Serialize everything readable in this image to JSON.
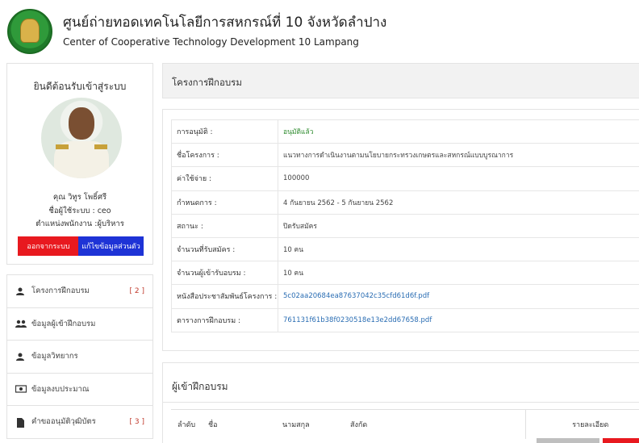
{
  "header": {
    "title_th": "ศูนย์ถ่ายทอดเทคโนโลยีการสหกรณ์ที่ 10 จังหวัดลำปาง",
    "title_en": "Center of Cooperative Technology Development 10 Lampang"
  },
  "profile": {
    "welcome": "ยินดีต้อนรับเข้าสู่ระบบ",
    "name": "คุณ วิทูร โพธิ์ศรี",
    "username": "ชื่อผู้ใช้ระบบ : ceo",
    "position": "ตำแหน่งพนักงาน :ผู้บริหาร",
    "logout_label": "ออกจากระบบ",
    "edit_label": "แก้ไขข้อมูลส่วนตัว"
  },
  "menu": [
    {
      "label": "โครงการฝึกอบรม",
      "count": "[ 2 ]",
      "icon": "user-icon"
    },
    {
      "label": "ข้อมูลผู้เข้าฝึกอบรม",
      "count": "",
      "icon": "users-icon"
    },
    {
      "label": "ข้อมูลวิทยากร",
      "count": "",
      "icon": "user-icon"
    },
    {
      "label": "ข้อมูลงบประมาณ",
      "count": "",
      "icon": "money-icon"
    },
    {
      "label": "คำขออนุมัติวุฒิบัตร",
      "count": "[ 3 ]",
      "icon": "file-icon"
    }
  ],
  "section": {
    "title": "โครงการฝึกอบรม"
  },
  "details": [
    {
      "key": "การอนุมัติ :",
      "value": "อนุมัติแล้ว",
      "style": "green"
    },
    {
      "key": "ชื่อโครงการ :",
      "value": "แนวทางการดำเนินงานตามนโยบายกระทรวงเกษตรและสหกรณ์แบบบูรณาการ",
      "style": ""
    },
    {
      "key": "ค่าใช้จ่าย :",
      "value": "100000",
      "style": ""
    },
    {
      "key": "กำหนดการ :",
      "value": "4 กันยายน 2562 - 5 กันยายน 2562",
      "style": ""
    },
    {
      "key": "สถานะ :",
      "value": "ปิดรับสมัคร",
      "style": ""
    },
    {
      "key": "จำนวนที่รับสมัคร :",
      "value": "10 คน",
      "style": ""
    },
    {
      "key": "จำนวนผู้เข้ารับอบรม :",
      "value": "10 คน",
      "style": ""
    },
    {
      "key": "หนังสือประชาสัมพันธ์โครงการ :",
      "value": "5c02aa20684ea87637042c35cfd61d6f.pdf",
      "style": "link"
    },
    {
      "key": "ตารางการฝึกอบรม :",
      "value": "761131f61b38f0230518e13e2dd67658.pdf",
      "style": "link"
    }
  ],
  "participants": {
    "title": "ผู้เข้าฝึกอบรม",
    "columns": [
      "ลำดับ",
      "ชื่อ",
      "นามสกุล",
      "สังกัด",
      "รายละเอียด"
    ]
  }
}
